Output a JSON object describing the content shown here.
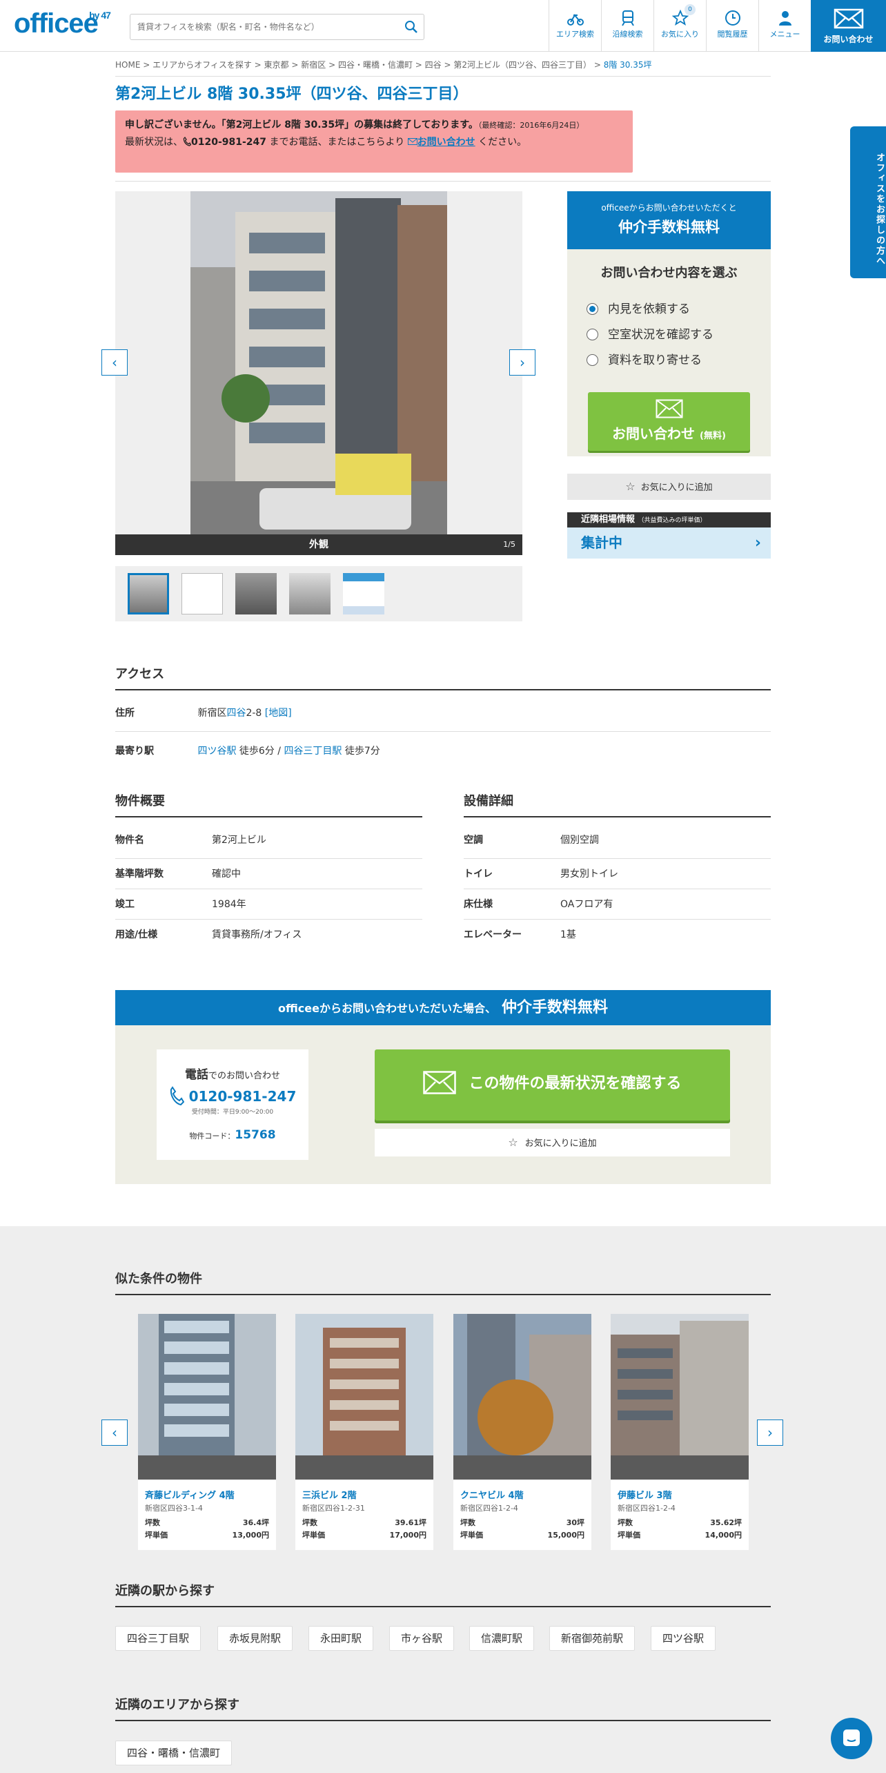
{
  "header": {
    "logo": "officee",
    "logo_sup": "by 47",
    "search_placeholder": "賃貸オフィスを検索（駅名・町名・物件名など）",
    "nav": [
      {
        "label": "エリア検索",
        "icon": "bike-icon"
      },
      {
        "label": "沿線検索",
        "icon": "train-icon"
      },
      {
        "label": "お気に入り",
        "icon": "star-icon",
        "badge": "0"
      },
      {
        "label": "閲覧履歴",
        "icon": "clock-icon"
      },
      {
        "label": "メニュー",
        "icon": "person-icon"
      }
    ],
    "contact_label": "お問い合わせ"
  },
  "breadcrumb": [
    "HOME",
    "エリアからオフィスを探す",
    "東京都",
    "新宿区",
    "四谷・曙橋・信濃町",
    "四谷",
    "第2河上ビル（四ツ谷、四谷三丁目）",
    "8階 30.35坪"
  ],
  "page_title": "第2河上ビル 8階 30.35坪（四ツ谷、四谷三丁目）",
  "notice": {
    "line1_pre": "申し訳ございません。「第2河上ビル 8階 30.35坪」の募集は終了しております。",
    "line1_date": "（最終確認：2016年6月24日）",
    "line2_pre": "最新状況は、",
    "phone": "0120-981-247",
    "line2_mid": " までお電話、またはこちらより",
    "link": "お問い合わせ",
    "line2_post": " ください。"
  },
  "gallery": {
    "caption": "外観",
    "counter": "1/5"
  },
  "sidebar": {
    "head_small": "officeeからお問い合わせいただくと",
    "head_big": "仲介手数料無料",
    "question": "お問い合わせ内容を選ぶ",
    "options": [
      "内見を依頼する",
      "空室状況を確認する",
      "資料を取り寄せる"
    ],
    "submit": "お問い合わせ",
    "submit_small": "(無料)",
    "fav": "お気に入りに追加",
    "market_title": "近隣相場情報",
    "market_small": "（共益費込みの坪単価）",
    "market_value": "集計中"
  },
  "access": {
    "heading": "アクセス",
    "address_label": "住所",
    "address_pre": "新宿区",
    "address_link": "四谷",
    "address_post": "2-8",
    "map_link": "[地図]",
    "station_label": "最寄り駅",
    "station1": "四ツ谷駅",
    "walk1": " 徒歩6分 / ",
    "station2": "四谷三丁目駅",
    "walk2": " 徒歩7分"
  },
  "overview": {
    "heading": "物件概要",
    "rows": [
      {
        "k": "物件名",
        "v": "第2河上ビル"
      },
      {
        "k": "基準階坪数",
        "v": "確認中"
      },
      {
        "k": "竣工",
        "v": "1984年"
      },
      {
        "k": "用途/仕様",
        "v": "賃貸事務所/オフィス"
      }
    ]
  },
  "equipment": {
    "heading": "設備詳細",
    "rows": [
      {
        "k": "空調",
        "v": "個別空調"
      },
      {
        "k": "トイレ",
        "v": "男女別トイレ"
      },
      {
        "k": "床仕様",
        "v": "OAフロア有"
      },
      {
        "k": "エレベーター",
        "v": "1基"
      }
    ]
  },
  "cta": {
    "head_pre": "officeeからお問い合わせいただいた場合、",
    "head_big": "仲介手数料無料",
    "tel_title": "電話",
    "tel_title_post": "でのお問い合わせ",
    "tel": "0120-981-247",
    "hours": "受付時間：平日9:00～20:00",
    "code_label": "物件コード：",
    "code": "15768",
    "button": "この物件の最新状況を確認する",
    "fav": "お気に入りに追加"
  },
  "similar": {
    "heading": "似た条件の物件",
    "k1": "坪数",
    "k2": "坪単価",
    "cards": [
      {
        "name": "斉藤ビルディング 4階",
        "addr": "新宿区四谷3-1-4",
        "tsubo": "36.4坪",
        "price": "13,000円"
      },
      {
        "name": "三浜ビル 2階",
        "addr": "新宿区四谷1-2-31",
        "tsubo": "39.61坪",
        "price": "17,000円"
      },
      {
        "name": "クニヤビル 4階",
        "addr": "新宿区四谷1-2-4",
        "tsubo": "30坪",
        "price": "15,000円"
      },
      {
        "name": "伊藤ビル 3階",
        "addr": "新宿区四谷1-2-4",
        "tsubo": "35.62坪",
        "price": "14,000円"
      }
    ]
  },
  "stations": {
    "heading": "近隣の駅から探す",
    "items": [
      "四谷三丁目駅",
      "赤坂見附駅",
      "永田町駅",
      "市ヶ谷駅",
      "信濃町駅",
      "新宿御苑前駅",
      "四ツ谷駅"
    ]
  },
  "areas": {
    "heading": "近隣のエリアから探す",
    "items": [
      "四谷・曙橋・信濃町"
    ]
  },
  "side_tab": "オフィスをお探しの方へ",
  "colors": {
    "brand": "#0b7bc0",
    "green": "#7fc241",
    "notice": "#f7a1a1"
  }
}
